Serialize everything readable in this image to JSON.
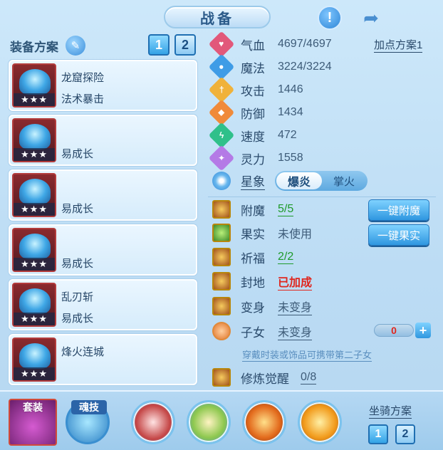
{
  "title": "战备",
  "left": {
    "header": "装备方案",
    "plan_buttons": [
      "1",
      "2"
    ],
    "cards": [
      {
        "line1": "龙窟探险",
        "line2": "法术暴击",
        "stars": "★★★"
      },
      {
        "line1": "",
        "line2": "易成长",
        "stars": "★★★"
      },
      {
        "line1": "",
        "line2": "易成长",
        "stars": "★★★"
      },
      {
        "line1": "",
        "line2": "易成长",
        "stars": "★★★"
      },
      {
        "line1": "乱刃斩",
        "line2": "易成长",
        "stars": "★★★"
      },
      {
        "line1": "烽火连城",
        "line2": "",
        "stars": "★★★"
      }
    ]
  },
  "stats": [
    {
      "name": "气血",
      "value": "4697/4697",
      "color": "#e2587a",
      "icon": "heart-icon"
    },
    {
      "name": "魔法",
      "value": "3224/3224",
      "color": "#3f9ce6",
      "icon": "mana-icon"
    },
    {
      "name": "攻击",
      "value": "1446",
      "color": "#f0b23a",
      "icon": "sword-icon"
    },
    {
      "name": "防御",
      "value": "1434",
      "color": "#f08a3a",
      "icon": "shield-icon"
    },
    {
      "name": "速度",
      "value": "472",
      "color": "#2fc08a",
      "icon": "lightning-icon"
    },
    {
      "name": "灵力",
      "value": "1558",
      "color": "#b47ae6",
      "icon": "spirit-icon"
    }
  ],
  "add_plan": "加点方案1",
  "starsign": {
    "name": "星象",
    "option_on": "爆炎",
    "option_off": "掌火"
  },
  "options": [
    {
      "name": "附魔",
      "value": "5/5",
      "style": "green"
    },
    {
      "name": "果实",
      "value": "未使用",
      "style": "plain"
    },
    {
      "name": "祈福",
      "value": "2/2",
      "style": "green"
    },
    {
      "name": "封地",
      "value": "已加成",
      "style": "red"
    },
    {
      "name": "变身",
      "value": "未变身",
      "style": "normal"
    },
    {
      "name": "子女",
      "value": "未变身",
      "style": "normal"
    },
    {
      "name": "修炼觉醒",
      "value": "0/8",
      "style": "normal"
    }
  ],
  "buttons": {
    "enchant": "一键附魔",
    "fruit": "一键果实"
  },
  "child": {
    "count": "0",
    "hint": "穿戴时装或饰品可携带第二子女"
  },
  "bottom": {
    "set_label": "套装",
    "soul_label": "魂技",
    "mount_label": "坐骑方案",
    "mount_buttons": [
      "1",
      "2"
    ]
  }
}
